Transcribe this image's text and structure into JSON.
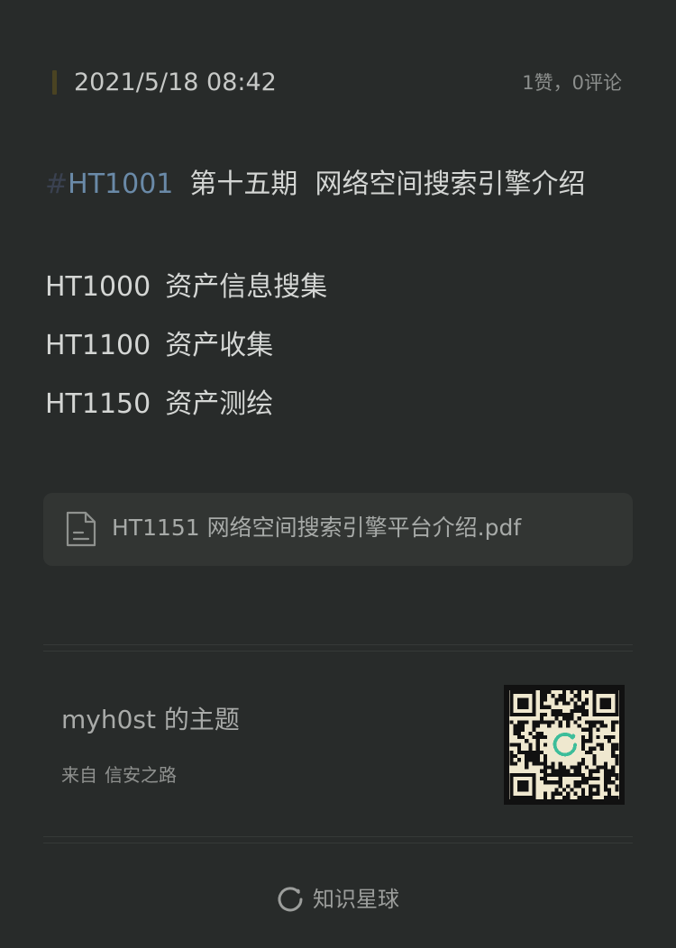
{
  "header": {
    "timestamp": "2021/5/18 08:42",
    "stats": "1赞，0评论"
  },
  "post": {
    "hash": "#",
    "tag": "HT1001",
    "title": "第十五期  网络空间搜索引擎介绍",
    "items": [
      {
        "code": "HT1000",
        "text": "资产信息搜集"
      },
      {
        "code": "HT1100",
        "text": "资产收集"
      },
      {
        "code": "HT1150",
        "text": "资产测绘"
      }
    ],
    "attachment": {
      "name": "HT1151 网络空间搜索引擎平台介绍.pdf",
      "icon": "document-icon"
    }
  },
  "author": {
    "title": "myh0st 的主题",
    "source_prefix": "来自",
    "source_name": "信安之路"
  },
  "footer": {
    "label": "知识星球",
    "icon": "planet-logo-icon"
  },
  "colors": {
    "background": "#282b2a",
    "tag": "#6a8aa8",
    "accent_bar": "#4a4322",
    "qr_background": "#efe8cf",
    "qr_logo": "#3dbd9a"
  }
}
